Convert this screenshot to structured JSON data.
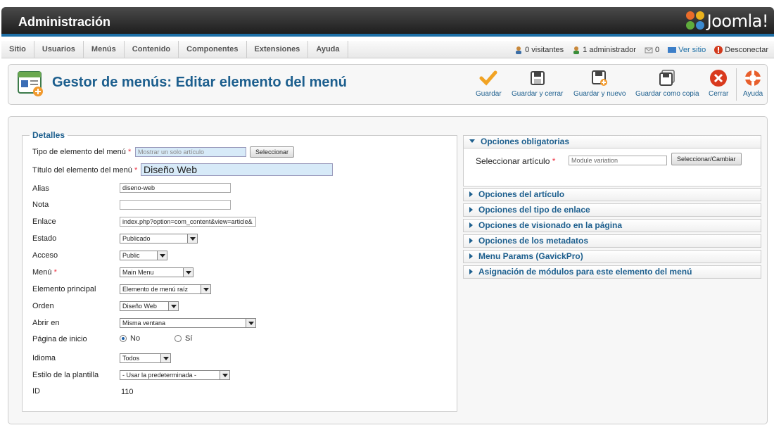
{
  "header": {
    "title": "Administración",
    "logo_text": "Joomla!"
  },
  "menubar": {
    "items": [
      "Sitio",
      "Usuarios",
      "Menús",
      "Contenido",
      "Componentes",
      "Extensiones",
      "Ayuda"
    ],
    "status": {
      "visitors": "0 visitantes",
      "admins": "1 administrador",
      "messages": "0",
      "view_site": "Ver sitio",
      "logout": "Desconectar"
    }
  },
  "toolbar": {
    "title": "Gestor de menús: Editar elemento del menú",
    "buttons": {
      "save": "Guardar",
      "save_close": "Guardar y cerrar",
      "save_new": "Guardar y nuevo",
      "save_copy": "Guardar como copia",
      "close": "Cerrar",
      "help": "Ayuda"
    }
  },
  "details": {
    "legend": "Detalles",
    "type_label": "Tipo de elemento del menú",
    "type_value": "Mostrar un solo artículo",
    "select_button": "Seleccionar",
    "title_label": "Título del elemento del menú",
    "title_value": "Diseño Web",
    "alias_label": "Alias",
    "alias_value": "diseno-web",
    "note_label": "Nota",
    "note_value": "",
    "link_label": "Enlace",
    "link_value": "index.php?option=com_content&view=article&",
    "state_label": "Estado",
    "state_value": "Publicado",
    "access_label": "Acceso",
    "access_value": "Public",
    "menu_label": "Menú",
    "menu_value": "Main Menu",
    "parent_label": "Elemento principal",
    "parent_value": "Elemento de menú raíz",
    "order_label": "Orden",
    "order_value": "Diseño Web",
    "open_label": "Abrir en",
    "open_value": "Misma ventana",
    "home_label": "Página de inicio",
    "home_no": "No",
    "home_yes": "Sí",
    "lang_label": "Idioma",
    "lang_value": "Todos",
    "style_label": "Estilo de la plantilla",
    "style_value": "- Usar la predeterminada -",
    "id_label": "ID",
    "id_value": "110"
  },
  "options": {
    "required": {
      "title": "Opciones obligatorias",
      "article_label": "Seleccionar artículo",
      "article_value": "Module variation",
      "change_button": "Seleccionar/Cambiar"
    },
    "panels": [
      "Opciones del artículo",
      "Opciones del tipo de enlace",
      "Opciones de visionado en la página",
      "Opciones de los metadatos",
      "Menu Params (GavickPro)",
      "Asignación de módulos para este elemento del menú"
    ]
  }
}
